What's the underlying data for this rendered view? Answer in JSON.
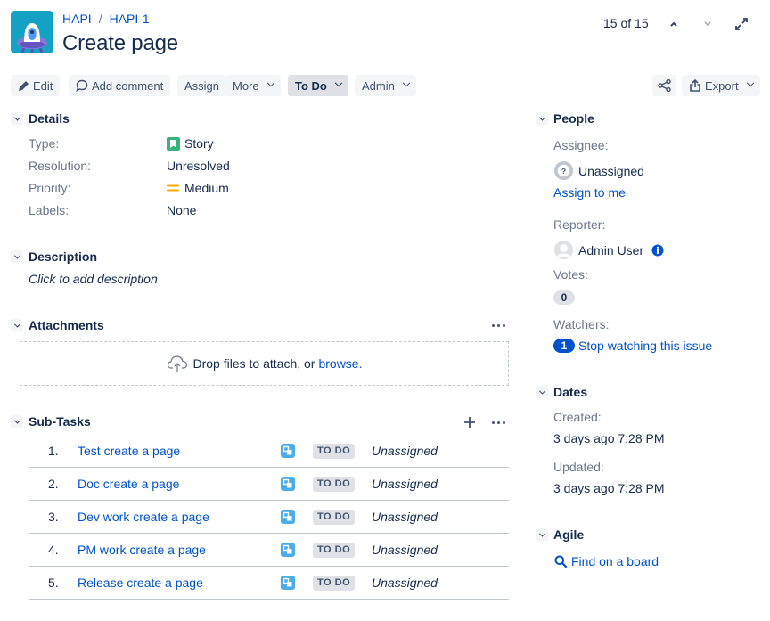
{
  "header": {
    "breadcrumb": [
      {
        "label": "HAPI"
      },
      {
        "label": "HAPI-1"
      }
    ],
    "separator": "/",
    "title": "Create page",
    "pager": "15 of 15",
    "icons": {
      "prev": "chevron-up-icon",
      "next": "chevron-down-icon",
      "expand": "expand-icon"
    }
  },
  "toolbar": {
    "edit": "Edit",
    "add_comment": "Add comment",
    "assign": "Assign",
    "more": "More",
    "status": "To Do",
    "admin": "Admin",
    "export": "Export"
  },
  "details": {
    "title": "Details",
    "fields": [
      {
        "label": "Type:",
        "value": "Story",
        "icon": "story-icon"
      },
      {
        "label": "Resolution:",
        "value": "Unresolved"
      },
      {
        "label": "Priority:",
        "value": "Medium",
        "icon": "priority-medium-icon"
      },
      {
        "label": "Labels:",
        "value": "None"
      }
    ]
  },
  "description": {
    "title": "Description",
    "placeholder": "Click to add description"
  },
  "attachments": {
    "title": "Attachments",
    "drop_text": "Drop files to attach, or",
    "browse": "browse."
  },
  "subtasks": {
    "title": "Sub-Tasks",
    "items": [
      {
        "num": "1.",
        "name": "Test create a page",
        "status": "TO DO",
        "assignee": "Unassigned"
      },
      {
        "num": "2.",
        "name": "Doc create a page",
        "status": "TO DO",
        "assignee": "Unassigned"
      },
      {
        "num": "3.",
        "name": "Dev work create a page",
        "status": "TO DO",
        "assignee": "Unassigned"
      },
      {
        "num": "4.",
        "name": "PM work create a page",
        "status": "TO DO",
        "assignee": "Unassigned"
      },
      {
        "num": "5.",
        "name": "Release create a page",
        "status": "TO DO",
        "assignee": "Unassigned"
      }
    ]
  },
  "people": {
    "title": "People",
    "assignee_label": "Assignee:",
    "assignee": "Unassigned",
    "assign_to_me": "Assign to me",
    "reporter_label": "Reporter:",
    "reporter": "Admin User",
    "votes_label": "Votes:",
    "votes": "0",
    "watchers_label": "Watchers:",
    "watchers": "1",
    "watch_action": "Stop watching this issue"
  },
  "dates": {
    "title": "Dates",
    "created_label": "Created:",
    "created": "3 days ago 7:28 PM",
    "updated_label": "Updated:",
    "updated": "3 days ago 7:28 PM"
  },
  "agile": {
    "title": "Agile",
    "find_on_board": "Find on a board"
  },
  "colors": {
    "link": "#0052cc",
    "text": "#172b4d",
    "muted": "#6b778c",
    "story": "#36b37e",
    "subtask": "#4bade8",
    "priority_medium": "#ffab00"
  }
}
